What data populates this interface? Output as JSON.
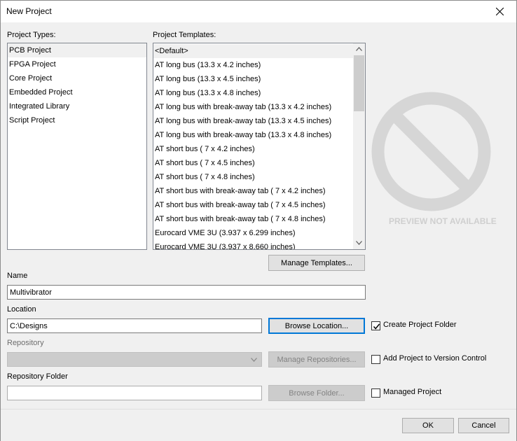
{
  "window": {
    "title": "New Project"
  },
  "project_types": {
    "label": "Project Types:",
    "items": [
      {
        "label": "PCB Project"
      },
      {
        "label": "FPGA Project"
      },
      {
        "label": "Core Project"
      },
      {
        "label": "Embedded Project"
      },
      {
        "label": "Integrated Library"
      },
      {
        "label": "Script Project"
      }
    ],
    "selected": "PCB Project"
  },
  "project_templates": {
    "label": "Project Templates:",
    "items": [
      {
        "label": "<Default>"
      },
      {
        "label": "AT long bus (13.3 x 4.2 inches)"
      },
      {
        "label": "AT long bus (13.3 x 4.5 inches)"
      },
      {
        "label": "AT long bus (13.3 x 4.8 inches)"
      },
      {
        "label": "AT long bus with break-away tab (13.3 x 4.2 inches)"
      },
      {
        "label": "AT long bus with break-away tab (13.3 x 4.5 inches)"
      },
      {
        "label": "AT long bus with break-away tab (13.3 x 4.8 inches)"
      },
      {
        "label": "AT short bus ( 7 x 4.2 inches)"
      },
      {
        "label": "AT short bus ( 7 x 4.5 inches)"
      },
      {
        "label": "AT short bus ( 7 x 4.8 inches)"
      },
      {
        "label": "AT short bus with break-away tab ( 7 x 4.2 inches)"
      },
      {
        "label": "AT short bus with break-away tab ( 7 x 4.5 inches)"
      },
      {
        "label": "AT short bus with break-away tab ( 7 x 4.8 inches)"
      },
      {
        "label": "Eurocard VME 3U (3.937 x 6.299 inches)"
      },
      {
        "label": "Eurocard VME 3U (3.937 x 8.660 inches)"
      }
    ],
    "selected": "<Default>",
    "manage_button": "Manage Templates..."
  },
  "preview": {
    "text": "PREVIEW NOT AVAILABLE",
    "icon": "no-preview-icon"
  },
  "name": {
    "label": "Name",
    "value": "Multivibrator"
  },
  "location": {
    "label": "Location",
    "value": "C:\\Designs",
    "browse_button": "Browse Location...",
    "create_folder_label": "Create Project Folder",
    "create_folder_checked": true
  },
  "repository": {
    "label": "Repository",
    "value": "",
    "manage_button": "Manage Repositories...",
    "version_control_label": "Add Project to Version Control",
    "version_control_checked": false
  },
  "repository_folder": {
    "label": "Repository Folder",
    "value": "",
    "browse_button": "Browse Folder...",
    "managed_label": "Managed Project",
    "managed_checked": false
  },
  "footer": {
    "ok_button": "OK",
    "cancel_button": "Cancel"
  },
  "colors": {
    "accent": "#0078d7",
    "selection": "#f0f0f0",
    "preview_gray": "#d6d6d6"
  }
}
